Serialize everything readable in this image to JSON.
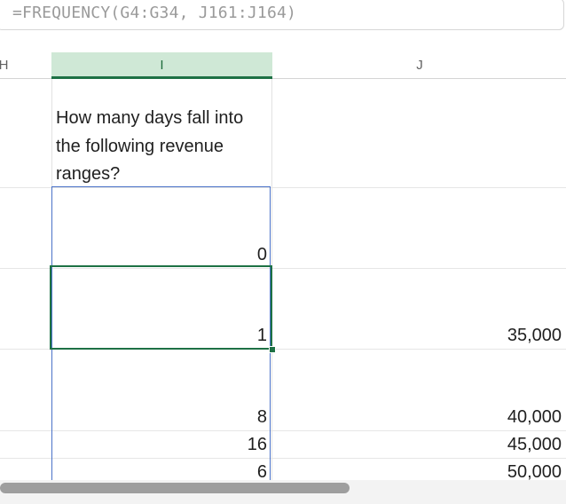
{
  "formula_bar": {
    "formula": "=FREQUENCY(G4:G34, J161:J164)"
  },
  "columns": {
    "h": "H",
    "i": "I",
    "j": "J"
  },
  "question": "How many days fall into the following revenue ranges?",
  "rows": [
    {
      "frequency": "0",
      "bin": ""
    },
    {
      "frequency": "1",
      "bin": "35,000"
    },
    {
      "frequency": "8",
      "bin": "40,000"
    },
    {
      "frequency": "16",
      "bin": "45,000"
    },
    {
      "frequency": "6",
      "bin": "50,000"
    }
  ],
  "colors": {
    "selection_green": "#1e7145",
    "header_selected_bg": "#cfe8d6",
    "range_border_blue": "#4a72c8"
  },
  "horizontal_scrollbar": {
    "scroll_position": 0.0
  }
}
